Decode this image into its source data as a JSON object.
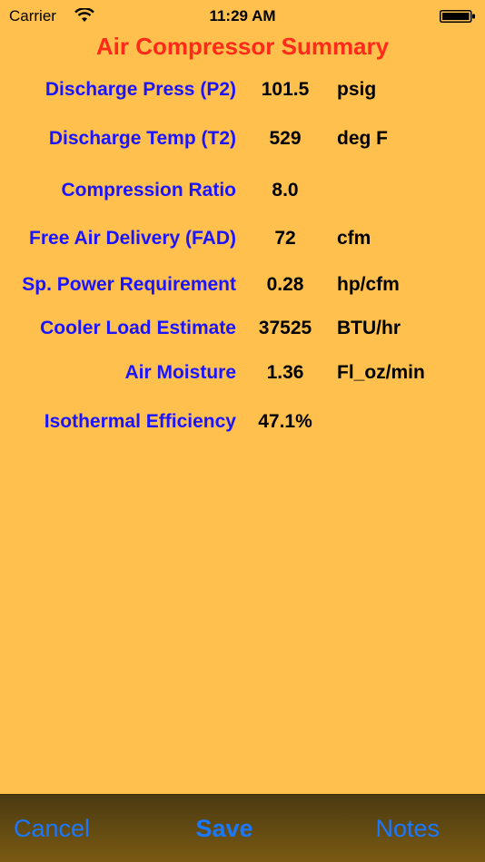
{
  "status_bar": {
    "carrier": "Carrier",
    "time": "11:29 AM"
  },
  "title": "Air Compressor Summary",
  "rows": [
    {
      "label": "Discharge Press (P2)",
      "value": "101.5",
      "unit": "psig"
    },
    {
      "label": "Discharge Temp (T2)",
      "value": "529",
      "unit": "deg F"
    },
    {
      "label": "Compression Ratio",
      "value": "8.0",
      "unit": ""
    },
    {
      "label": "Free Air Delivery (FAD)",
      "value": "72",
      "unit": "cfm"
    },
    {
      "label": "Sp. Power Requirement",
      "value": "0.28",
      "unit": "hp/cfm"
    },
    {
      "label": "Cooler Load Estimate",
      "value": "37525",
      "unit": "BTU/hr"
    },
    {
      "label": "Air Moisture",
      "value": "1.36",
      "unit": "Fl_oz/min"
    },
    {
      "label": "Isothermal Efficiency",
      "value": "47.1%",
      "unit": ""
    }
  ],
  "toolbar": {
    "cancel_label": "Cancel",
    "save_label": "Save",
    "notes_label": "Notes"
  },
  "colors": {
    "background": "#ffc04d",
    "title": "#ff2a1a",
    "label": "#1a14ff",
    "button": "#1a78ff"
  },
  "icons": [
    "wifi-icon",
    "battery-icon"
  ]
}
